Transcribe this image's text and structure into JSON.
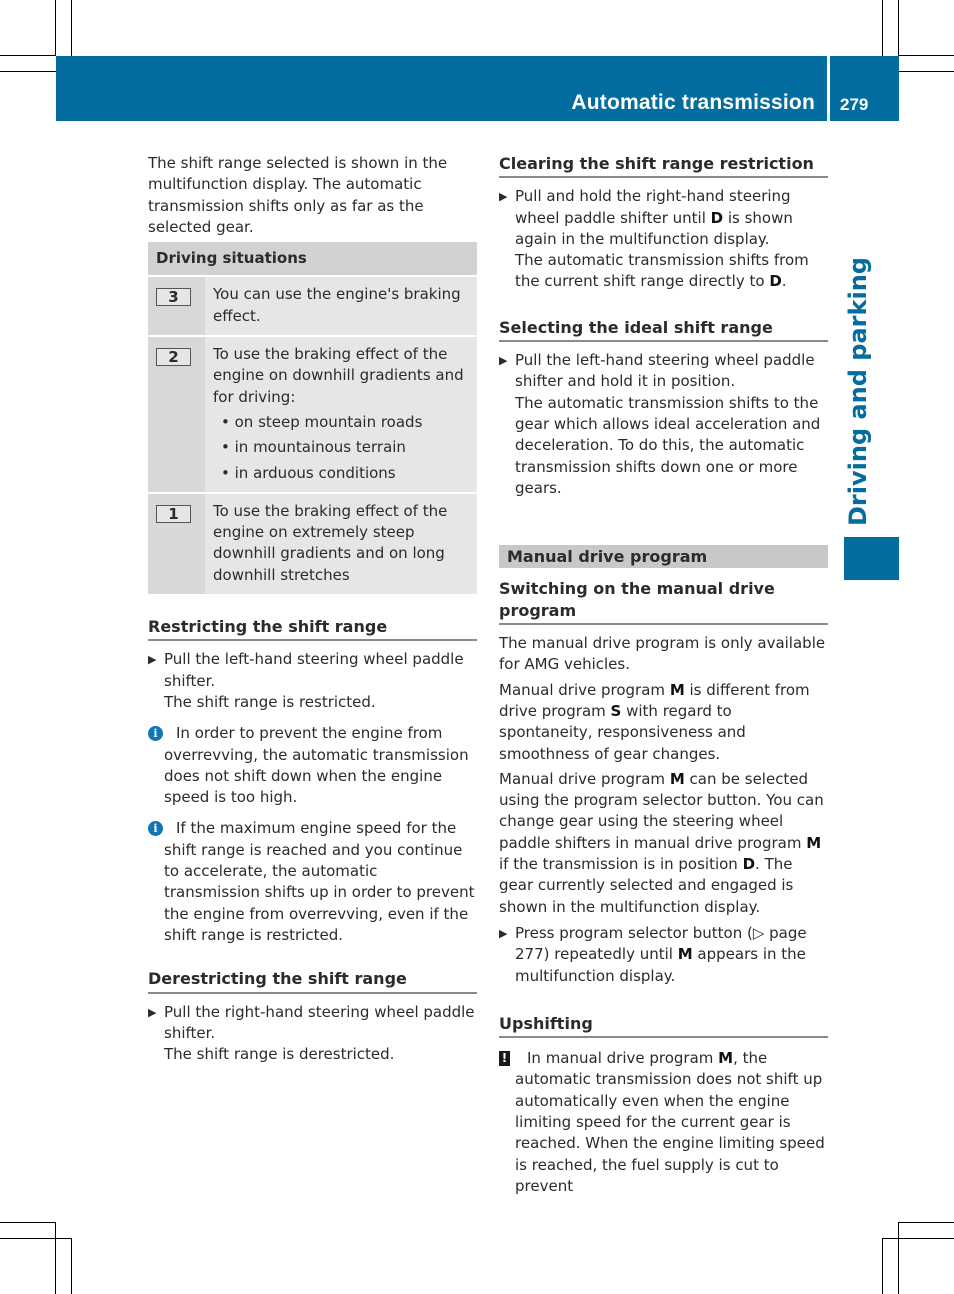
{
  "header": {
    "title": "Automatic transmission",
    "page_number": "279",
    "accent_color": "#036d9f"
  },
  "side_tab": {
    "label": "Driving and parking"
  },
  "left": {
    "intro": "The shift range selected is shown in the multifunction display. The automatic transmission shifts only as far as the selected gear.",
    "table": {
      "header": "Driving situations",
      "rows": [
        {
          "key": "3",
          "text": "You can use the engine's braking effect.",
          "bullets": []
        },
        {
          "key": "2",
          "text": "To use the braking effect of the engine on downhill gradients and for driving:",
          "bullets": [
            "on steep mountain roads",
            "in mountainous terrain",
            "in arduous conditions"
          ]
        },
        {
          "key": "1",
          "text": "To use the braking effect of the engine on extremely steep downhill gradients and on long downhill stretches",
          "bullets": []
        }
      ]
    },
    "restricting": {
      "heading": "Restricting the shift range",
      "step": "Pull the left-hand steering wheel paddle shifter.",
      "result": "The shift range is restricted.",
      "notes": [
        "In order to prevent the engine from overrevving, the automatic transmission does not shift down when the engine speed is too high.",
        "If the maximum engine speed for the shift range is reached and you continue to accelerate, the automatic transmission shifts up in order to prevent the engine from overrevving, even if the shift range is restricted."
      ]
    },
    "derestricting": {
      "heading": "Derestricting the shift range",
      "step": "Pull the right-hand steering wheel paddle shifter.",
      "result": "The shift range is derestricted."
    }
  },
  "right": {
    "clearing": {
      "heading": "Clearing the shift range restriction",
      "step_a": "Pull and hold the right-hand steering wheel paddle shifter until ",
      "step_b": "D",
      "step_c": " is shown again in the multifunction display.",
      "result_a": "The automatic transmission shifts from the current shift range directly to ",
      "result_b": "D",
      "result_c": "."
    },
    "ideal": {
      "heading": "Selecting the ideal shift range",
      "step": "Pull the left-hand steering wheel paddle shifter and hold it in position.",
      "result": "The automatic transmission shifts to the gear which allows ideal acceleration and deceleration. To do this, the automatic transmission shifts down one or more gears."
    },
    "manual": {
      "section": "Manual drive program",
      "heading": "Switching on the manual drive program",
      "p1": "The manual drive program is only available for AMG vehicles.",
      "p2_a": "Manual drive program ",
      "p2_b": "M",
      "p2_c": " is different from drive program ",
      "p2_d": "S",
      "p2_e": " with regard to spontaneity, responsiveness and smoothness of gear changes.",
      "p3_a": "Manual drive program ",
      "p3_b": "M",
      "p3_c": " can be selected using the program selector button. You can change gear using the steering wheel paddle shifters in manual drive program ",
      "p3_d": "M",
      "p3_e": " if the transmission is in position ",
      "p3_f": "D",
      "p3_g": ". The gear currently selected and engaged is shown in the multifunction display.",
      "step_a": "Press program selector button (",
      "step_ref": "▷ page 277",
      "step_b": ") repeatedly until ",
      "step_c": "M",
      "step_d": " appears in the multifunction display."
    },
    "upshifting": {
      "heading": "Upshifting",
      "warn_a": "In manual drive program ",
      "warn_b": "M",
      "warn_c": ", the automatic transmission does not shift up automatically even when the engine limiting speed for the current gear is reached. When the engine limiting speed is reached, the fuel supply is cut to prevent"
    }
  }
}
